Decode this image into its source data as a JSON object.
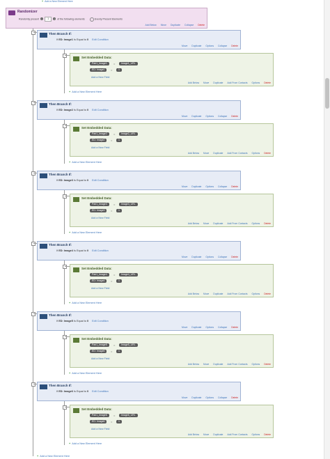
{
  "top_link": "Add a New Element Here",
  "randomizer": {
    "title": "Randomizer",
    "pre": "Randomly present",
    "count": "1",
    "post": "of the following elements",
    "evenly": "Evenly Present Elements",
    "actions": [
      "Add Below",
      "Move",
      "Duplicate",
      "Collapse",
      "Delete"
    ]
  },
  "branch_actions": [
    "Move",
    "Duplicate",
    "Options",
    "Collapse",
    "Delete"
  ],
  "embed_actions": [
    "Add Below",
    "Move",
    "Duplicate",
    "Add From Contacts",
    "Options",
    "Delete"
  ],
  "labels": {
    "branch_title": "Then Branch If:",
    "embed_title": "Set Embedded Data:",
    "add_field": "Add a New Field",
    "add_element": "Add a New Element Here",
    "edit_condition": "Edit Condition",
    "is_equal": "Is Equal to",
    "if": "If",
    "eq_sign": "=",
    "value": "1",
    "minus": "−"
  },
  "branches": [
    {
      "cond_field": "ED: Image1",
      "cond_value": "0",
      "pill1": "Pair1_Image1",
      "pill2": "Image1_URL",
      "pill3": "ED: Image1"
    },
    {
      "cond_field": "ED: Image2",
      "cond_value": "0",
      "pill1": "Pair1_Image2",
      "pill2": "Image2_URL",
      "pill3": "ED: Image2"
    },
    {
      "cond_field": "ED: Image3",
      "cond_value": "0",
      "pill1": "Pair1_Image3",
      "pill2": "Image3_URL",
      "pill3": "ED: Image3"
    },
    {
      "cond_field": "ED: Image4",
      "cond_value": "0",
      "pill1": "Pair1_Image4",
      "pill2": "Image4_URL",
      "pill3": "ED: Image4"
    },
    {
      "cond_field": "ED: Image5",
      "cond_value": "0",
      "pill1": "Pair1_Image5",
      "pill2": "Image5_URL",
      "pill3": "ED: Image5"
    },
    {
      "cond_field": "ED: Image6",
      "cond_value": "0",
      "pill1": "Pair1_Image6",
      "pill2": "Image6_URL",
      "pill3": "ED: Image6"
    }
  ],
  "bottom_link": "Add a New Element Here"
}
